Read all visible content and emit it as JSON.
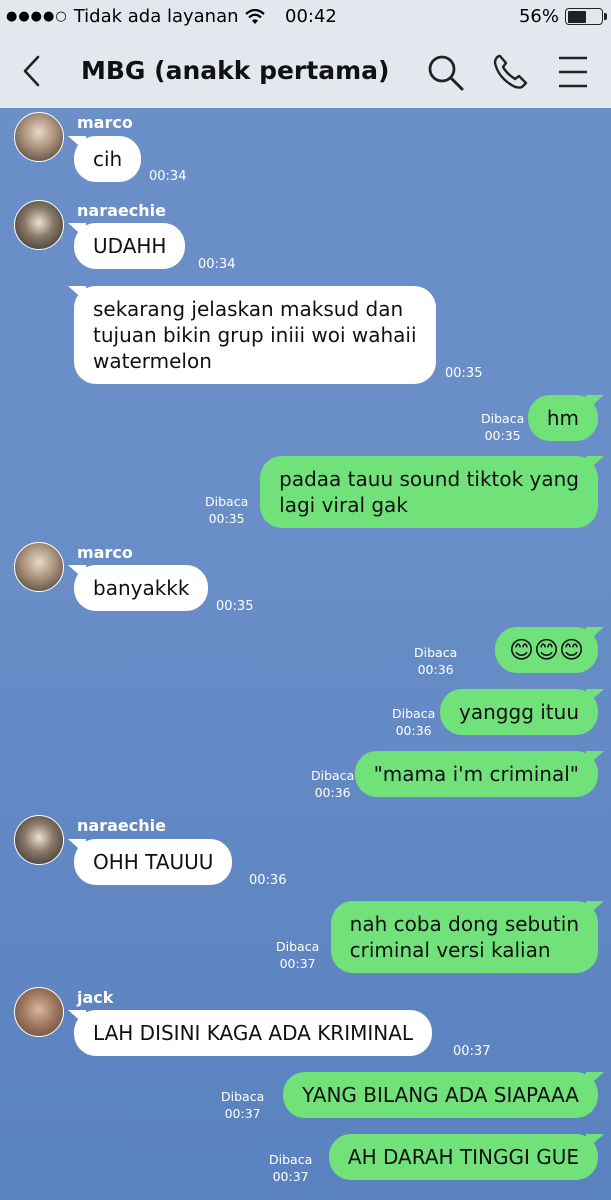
{
  "status": {
    "carrier": "Tidak ada layanan",
    "time": "00:42",
    "battery": "56%",
    "battery_level": 0.56
  },
  "header": {
    "title": "MBG (anakk pertama)"
  },
  "read_label": "Dibaca",
  "messages": [
    {
      "sender": "marco",
      "text": "cih",
      "time": "00:34"
    },
    {
      "sender": "naraechie",
      "text": "UDAHH",
      "time": "00:34"
    },
    {
      "text": "sekarang jelaskan maksud dan\ntujuan bikin grup iniii woi wahaii\nwatermelon",
      "time": "00:35"
    },
    {
      "text": "hm",
      "time": "00:35"
    },
    {
      "text": "padaa tauu sound tiktok yang\nlagi viral gak",
      "time": "00:35"
    },
    {
      "sender": "marco",
      "text": "banyakkk",
      "time": "00:35"
    },
    {
      "text": "😊😊😊",
      "time": "00:36"
    },
    {
      "text": "yanggg ituu",
      "time": "00:36"
    },
    {
      "text": "\"mama i'm criminal\"",
      "time": "00:36"
    },
    {
      "sender": "naraechie",
      "text": "OHH TAUUU",
      "time": "00:36"
    },
    {
      "text": "nah coba dong sebutin\ncriminal versi kalian",
      "time": "00:37"
    },
    {
      "sender": "jack",
      "text": "LAH DISINI KAGA ADA KRIMINAL",
      "time": "00:37"
    },
    {
      "text": "YANG BILANG ADA SIAPAAA",
      "time": "00:37"
    },
    {
      "text": "AH DARAH TINGGI GUE",
      "time": "00:37"
    }
  ]
}
